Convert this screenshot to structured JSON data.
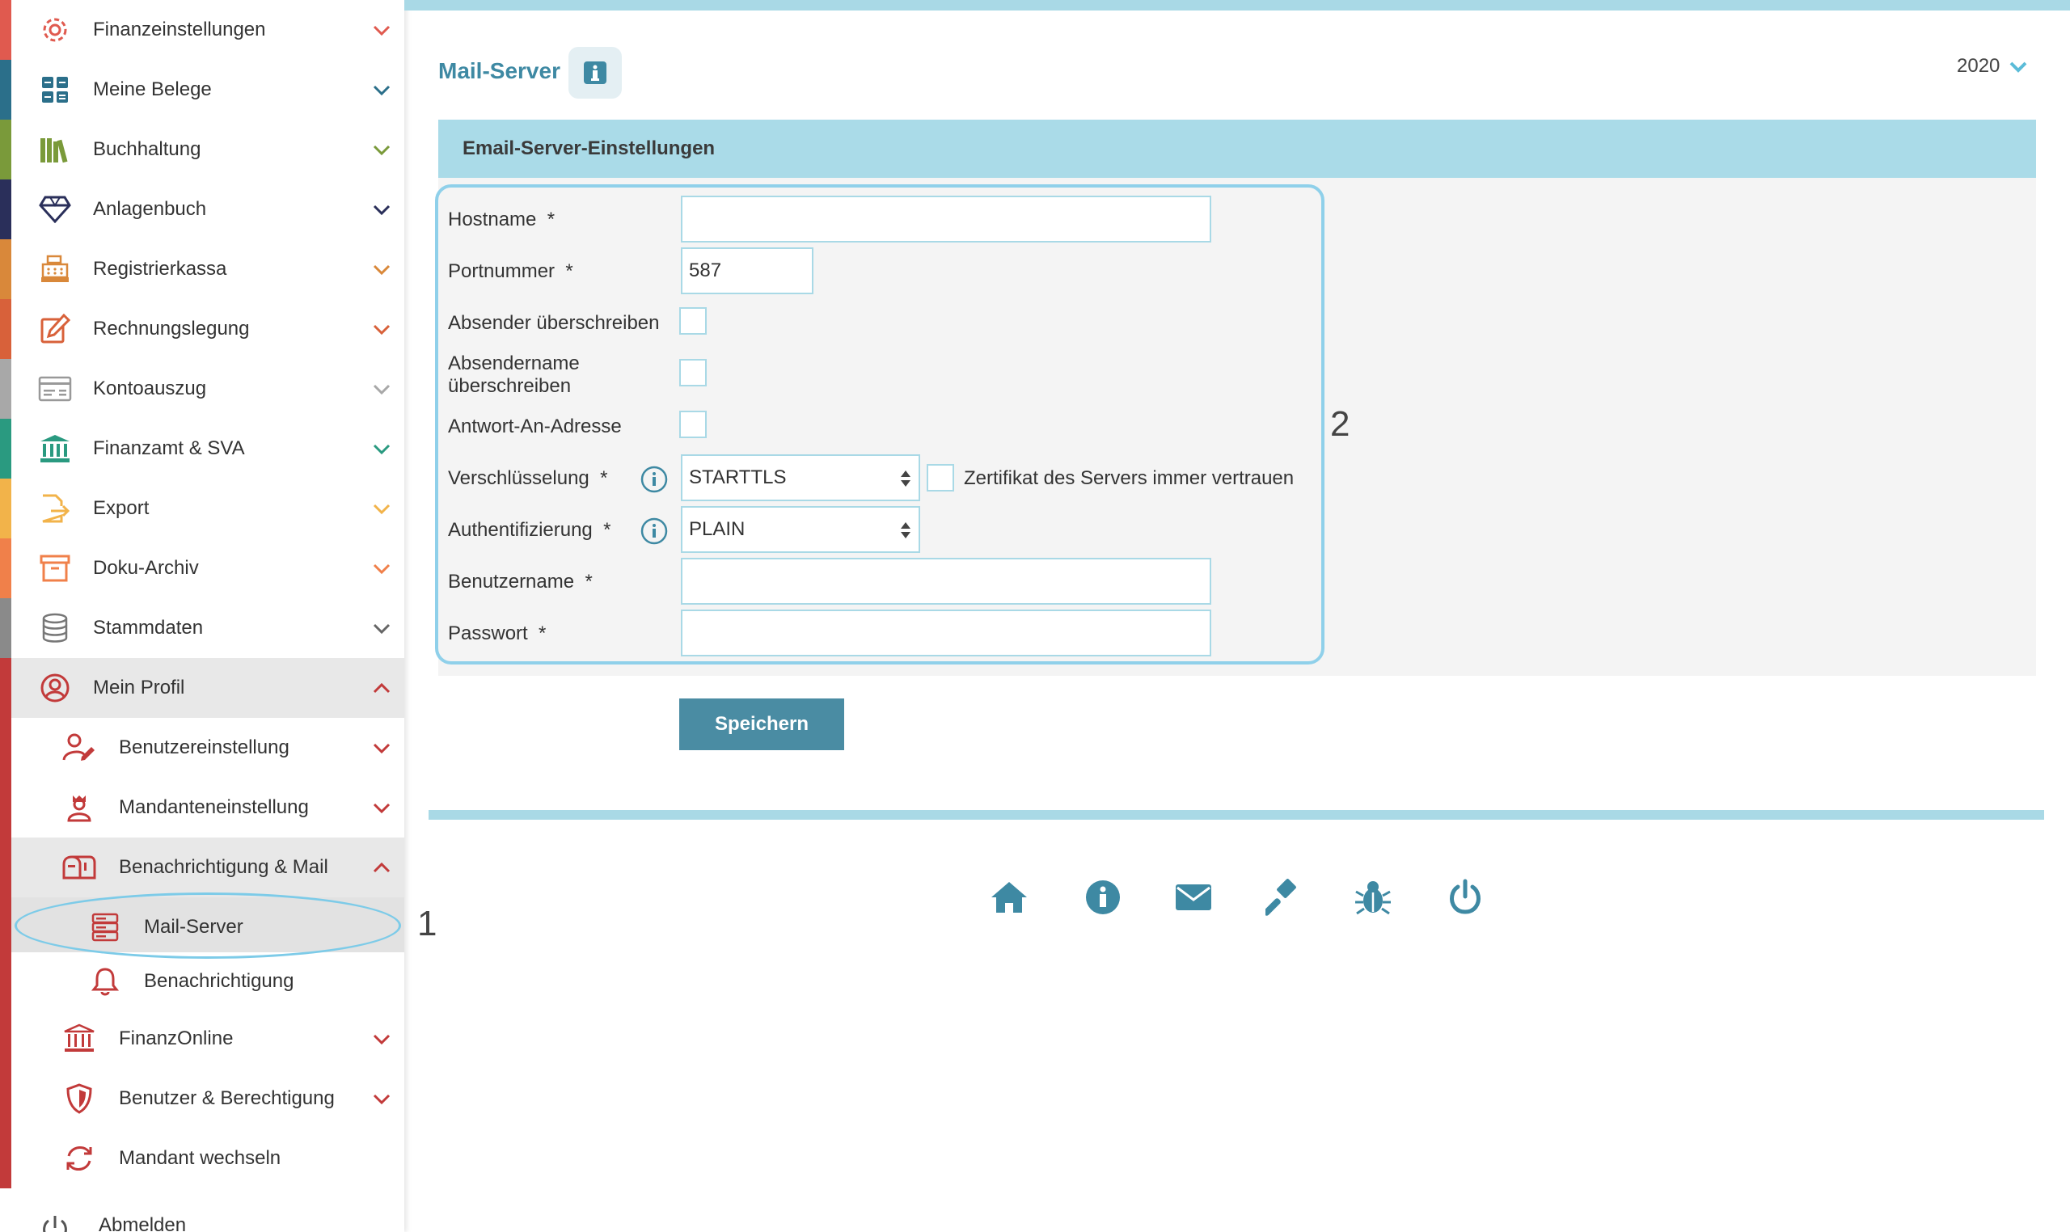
{
  "colors": {
    "accent": "#3e89a3",
    "header_bg": "#aadbe8",
    "button": "#4a8ca3",
    "highlight": "#8fd0ea"
  },
  "sidebar": {
    "items": [
      {
        "label": "Finanzeinstellungen",
        "icon": "gear-icon",
        "color": "#e05a4f",
        "chevron": "down"
      },
      {
        "label": "Meine Belege",
        "icon": "calculator-icon",
        "color": "#2b6f8a",
        "chevron": "down"
      },
      {
        "label": "Buchhaltung",
        "icon": "books-icon",
        "color": "#7a9a3a",
        "chevron": "down"
      },
      {
        "label": "Anlagenbuch",
        "icon": "diamond-icon",
        "color": "#2a2f5a",
        "chevron": "down"
      },
      {
        "label": "Registrierkassa",
        "icon": "cash-register-icon",
        "color": "#d9883a",
        "chevron": "down"
      },
      {
        "label": "Rechnungslegung",
        "icon": "edit-icon",
        "color": "#d8613a",
        "chevron": "down"
      },
      {
        "label": "Kontoauszug",
        "icon": "statement-icon",
        "color": "#a8a8a8",
        "chevron": "down"
      },
      {
        "label": "Finanzamt & SVA",
        "icon": "bank-icon",
        "color": "#2a9a80",
        "chevron": "down"
      },
      {
        "label": "Export",
        "icon": "export-icon",
        "color": "#f2b34a",
        "chevron": "down"
      },
      {
        "label": "Doku-Archiv",
        "icon": "archive-icon",
        "color": "#f0804a",
        "chevron": "down"
      },
      {
        "label": "Stammdaten",
        "icon": "database-icon",
        "color": "#8a8a8a",
        "chevron": "down"
      },
      {
        "label": "Mein Profil",
        "icon": "user-circle-icon",
        "color": "#c23a3a",
        "chevron": "up"
      }
    ],
    "profile_sub": [
      {
        "label": "Benutzereinstellung",
        "icon": "user-edit-icon",
        "chevron": "down"
      },
      {
        "label": "Mandanteneinstellung",
        "icon": "client-icon",
        "chevron": "down"
      },
      {
        "label": "Benachrichtigung & Mail",
        "icon": "mailbox-icon",
        "chevron": "up"
      }
    ],
    "mail_sub": [
      {
        "label": "Mail-Server",
        "icon": "server-icon"
      },
      {
        "label": "Benachrichtigung",
        "icon": "bell-icon"
      }
    ],
    "profile_sub_more": [
      {
        "label": "FinanzOnline",
        "icon": "bank-icon",
        "chevron": "down"
      },
      {
        "label": "Benutzer & Berechtigung",
        "icon": "shield-icon",
        "chevron": "down"
      },
      {
        "label": "Mandant wechseln",
        "icon": "sync-icon",
        "chevron": ""
      }
    ],
    "logout": {
      "label": "Abmelden",
      "icon": "power-icon"
    },
    "annotation": "1"
  },
  "main": {
    "title": "Mail-Server",
    "year": "2020",
    "panel_title": "Email-Server-Einstellungen",
    "annotation": "2",
    "form": {
      "hostname_label": "Hostname",
      "hostname_value": "",
      "port_label": "Portnummer",
      "port_value": "587",
      "override_sender_label": "Absender überschreiben",
      "override_sender_name_label_1": "Absendername",
      "override_sender_name_label_2": "überschreiben",
      "reply_to_label": "Antwort-An-Adresse",
      "encryption_label": "Verschlüsselung",
      "encryption_value": "STARTTLS",
      "trust_cert_label": "Zertifikat des Servers immer vertrauen",
      "auth_label": "Authentifizierung",
      "auth_value": "PLAIN",
      "username_label": "Benutzername",
      "username_value": "",
      "password_label": "Passwort",
      "password_value": "",
      "required_mark": "*"
    },
    "save_label": "Speichern"
  },
  "footer": {
    "icons": [
      "home-icon",
      "info-icon",
      "envelope-icon",
      "gavel-icon",
      "bug-icon",
      "power-icon"
    ]
  }
}
